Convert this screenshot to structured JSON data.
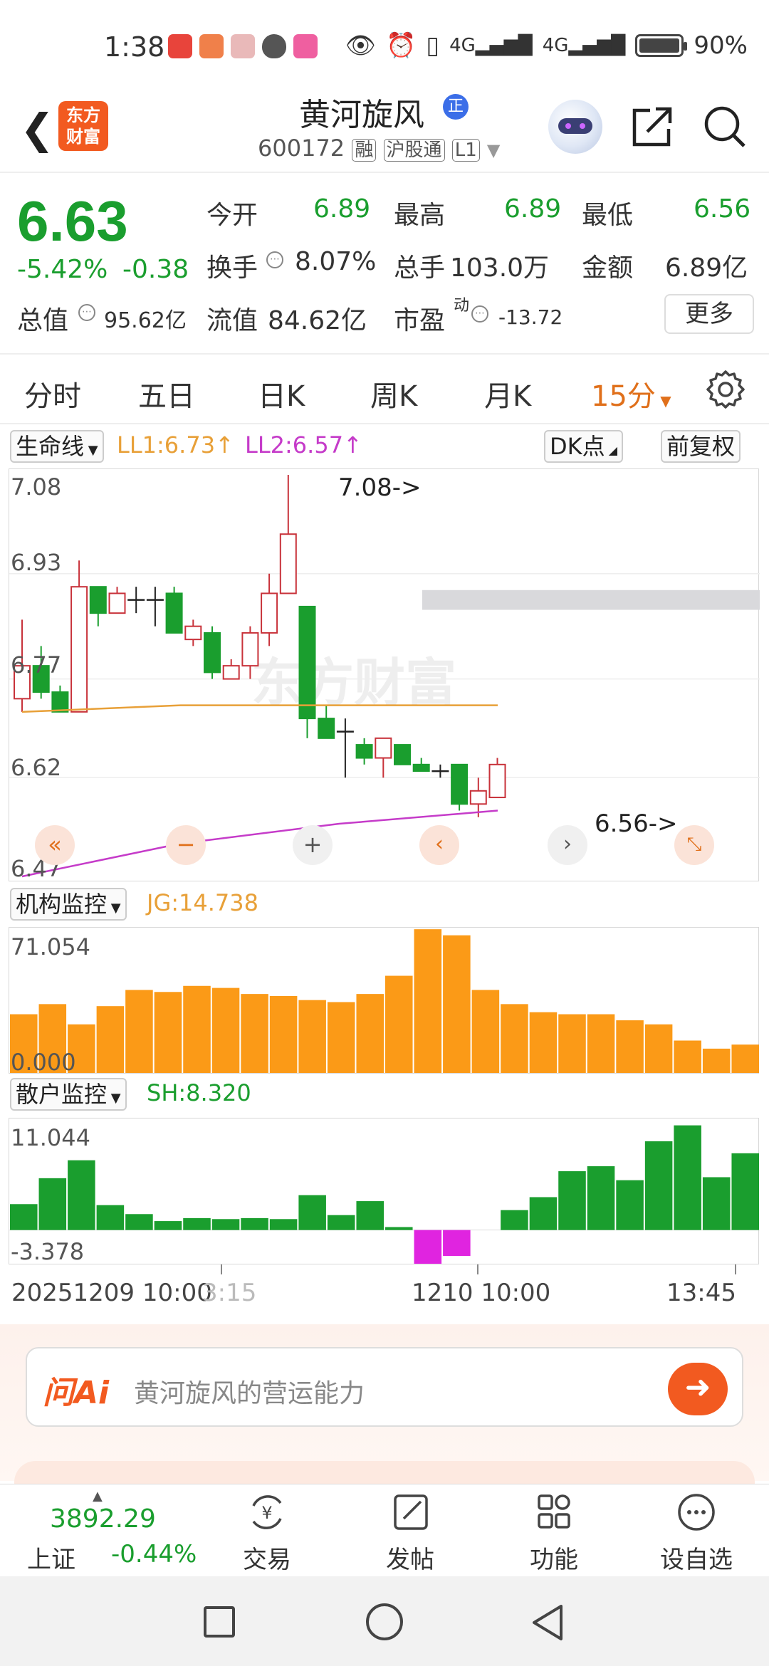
{
  "status": {
    "time": "1:38",
    "battery": "90%",
    "battery_level": 0.9
  },
  "header": {
    "logo_line1": "东方",
    "logo_line2": "财富",
    "stock_name": "黄河旋风",
    "badge": "正",
    "code": "600172",
    "tags": [
      "融",
      "沪股通",
      "L1"
    ]
  },
  "quote": {
    "price": "6.63",
    "change_pct": "-5.42%",
    "change_abs": "-0.38",
    "open_label": "今开",
    "open": "6.89",
    "high_label": "最高",
    "high": "6.89",
    "low_label": "最低",
    "low": "6.56",
    "turnover_label": "换手",
    "turnover": "8.07%",
    "volume_label": "总手",
    "volume": "103.0万",
    "amount_label": "金额",
    "amount": "6.89亿",
    "mcap_label": "总值",
    "mcap": "95.62亿",
    "float_label": "流值",
    "float_cap": "84.62亿",
    "pe_label": "市盈",
    "pe_sup": "动",
    "pe": "-13.72",
    "more": "更多"
  },
  "tabs": [
    "分时",
    "五日",
    "日K",
    "周K",
    "月K",
    "15分"
  ],
  "active_tab": "15分",
  "kline_toolbar": {
    "indicator": "生命线",
    "ll1": "LL1:6.73↑",
    "ll2": "LL2:6.57↑",
    "dk": "DK点",
    "adjust": "前复权"
  },
  "colors": {
    "up": "#c8323a",
    "down": "#1a9e2e",
    "ll1": "#e8a038",
    "ll2": "#c53bc9",
    "bar_orange": "#fb9a17",
    "bar_magenta": "#e024e0"
  },
  "chart_data": [
    {
      "type": "candlestick",
      "y_ticks": [
        "7.08",
        "6.93",
        "6.77",
        "6.62",
        "6.47"
      ],
      "ylim": [
        6.47,
        7.08
      ],
      "annotations": [
        "7.08->",
        "6.56->"
      ],
      "watermark": "东方财富",
      "candles": [
        {
          "o": 6.74,
          "c": 6.79,
          "h": 6.86,
          "l": 6.72
        },
        {
          "o": 6.79,
          "c": 6.75,
          "h": 6.82,
          "l": 6.74
        },
        {
          "o": 6.75,
          "c": 6.72,
          "h": 6.76,
          "l": 6.72
        },
        {
          "o": 6.72,
          "c": 6.91,
          "h": 6.95,
          "l": 6.72
        },
        {
          "o": 6.91,
          "c": 6.87,
          "h": 6.91,
          "l": 6.85
        },
        {
          "o": 6.87,
          "c": 6.9,
          "h": 6.91,
          "l": 6.87
        },
        {
          "o": 6.89,
          "c": 6.89,
          "h": 6.91,
          "l": 6.87
        },
        {
          "o": 6.89,
          "c": 6.89,
          "h": 6.91,
          "l": 6.85
        },
        {
          "o": 6.9,
          "c": 6.84,
          "h": 6.91,
          "l": 6.84
        },
        {
          "o": 6.83,
          "c": 6.85,
          "h": 6.86,
          "l": 6.82
        },
        {
          "o": 6.84,
          "c": 6.78,
          "h": 6.85,
          "l": 6.77
        },
        {
          "o": 6.77,
          "c": 6.79,
          "h": 6.8,
          "l": 6.77
        },
        {
          "o": 6.79,
          "c": 6.84,
          "h": 6.85,
          "l": 6.77
        },
        {
          "o": 6.84,
          "c": 6.9,
          "h": 6.93,
          "l": 6.82
        },
        {
          "o": 6.9,
          "c": 6.99,
          "h": 7.08,
          "l": 6.9
        },
        {
          "o": 6.88,
          "c": 6.71,
          "h": 6.88,
          "l": 6.68
        },
        {
          "o": 6.71,
          "c": 6.68,
          "h": 6.73,
          "l": 6.68
        },
        {
          "o": 6.69,
          "c": 6.69,
          "h": 6.71,
          "l": 6.62
        },
        {
          "o": 6.67,
          "c": 6.65,
          "h": 6.68,
          "l": 6.64
        },
        {
          "o": 6.65,
          "c": 6.68,
          "h": 6.68,
          "l": 6.62
        },
        {
          "o": 6.67,
          "c": 6.64,
          "h": 6.67,
          "l": 6.64
        },
        {
          "o": 6.64,
          "c": 6.63,
          "h": 6.65,
          "l": 6.63
        },
        {
          "o": 6.63,
          "c": 6.63,
          "h": 6.64,
          "l": 6.62
        },
        {
          "o": 6.64,
          "c": 6.58,
          "h": 6.64,
          "l": 6.57
        },
        {
          "o": 6.58,
          "c": 6.6,
          "h": 6.62,
          "l": 6.56
        },
        {
          "o": 6.59,
          "c": 6.64,
          "h": 6.65,
          "l": 6.59
        }
      ],
      "ll1_line": [
        6.72,
        6.73,
        6.73,
        6.73
      ],
      "ll2_line": [
        6.47,
        6.52,
        6.55,
        6.57
      ]
    },
    {
      "type": "bar",
      "indicator": "机构监控",
      "value_label": "JG:14.738",
      "y_ticks": [
        "71.054",
        "0.000"
      ],
      "ylim": [
        0,
        71.054
      ],
      "values": [
        29,
        34,
        24,
        33,
        41,
        40,
        43,
        42,
        39,
        38,
        36,
        35,
        39,
        48,
        71,
        68,
        41,
        34,
        30,
        29,
        29,
        26,
        24,
        16,
        12,
        14
      ]
    },
    {
      "type": "bar",
      "indicator": "散户监控",
      "value_label": "SH:8.320",
      "y_ticks": [
        "11.044",
        "-3.378"
      ],
      "ylim": [
        -3.378,
        11.044
      ],
      "values": [
        2.6,
        5.2,
        7.0,
        2.5,
        1.6,
        0.9,
        1.2,
        1.1,
        1.2,
        1.1,
        3.5,
        1.5,
        2.9,
        0.3,
        -3.378,
        -2.6,
        0,
        2.0,
        3.3,
        5.9,
        6.4,
        5.0,
        8.9,
        10.5,
        5.3,
        7.7
      ]
    }
  ],
  "time_axis": {
    "left": "20251209 10:00",
    "left2": "3:15",
    "mid": "1210 10:00",
    "right": "13:45"
  },
  "ai": {
    "logo": "问Ai",
    "placeholder": "黄河旋风的营运能力"
  },
  "bottom_nav": {
    "index_value": "3892.29",
    "index_name": "上证",
    "index_change": "-0.44%",
    "items": [
      "交易",
      "发帖",
      "功能",
      "设自选"
    ]
  }
}
